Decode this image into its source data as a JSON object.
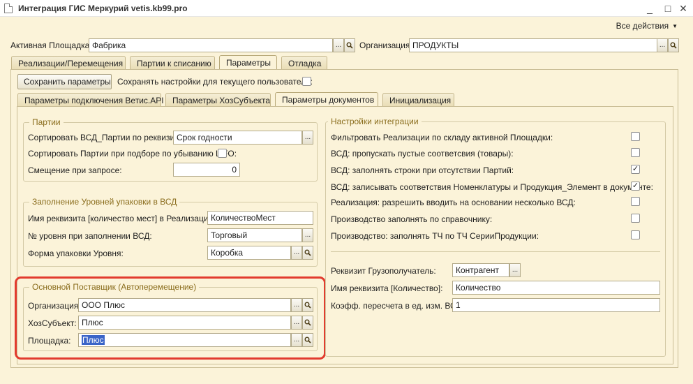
{
  "window": {
    "title": "Интеграция ГИС Меркурий vetis.kb99.pro",
    "minimize": "_",
    "maximize": "□",
    "close": "✕"
  },
  "toolbar": {
    "all_actions": "Все действия"
  },
  "header": {
    "platform_label": "Активная Площадка:",
    "platform_value": "Фабрика",
    "org_label": "Организация:",
    "org_value": "ПРОДУКТЫ"
  },
  "tabs": [
    "Реализации/Перемещения",
    "Партии к списанию",
    "Параметры",
    "Отладка"
  ],
  "params": {
    "save_button": "Сохранить параметры",
    "save_for_user_label": "Сохранять настройки для текущего пользователя:",
    "save_for_user_checked": false
  },
  "subtabs": [
    "Параметры подключения Ветис.API",
    "Параметры ХозСубъекта",
    "Параметры документов",
    "Инициализация"
  ],
  "batches": {
    "title": "Партии",
    "sort_vsd_label": "Сортировать ВСД_Партии по реквизиту:",
    "sort_vsd_value": "Срок годности",
    "sort_lifo_label": "Сортировать Партии при подборе по убыванию LIFO:",
    "sort_lifo_checked": false,
    "offset_label": "Смещение при запросе:",
    "offset_value": "0"
  },
  "packaging": {
    "title": "Заполнение Уровней упаковки в ВСД",
    "qty_attr_label": "Имя реквизита [количество мест] в Реализации:",
    "qty_attr_value": "КоличествоМест",
    "level_label": "№ уровня при заполнении ВСД:",
    "level_value": "Торговый",
    "form_label": "Форма упаковки Уровня:",
    "form_value": "Коробка"
  },
  "supplier": {
    "title": "Основной Поставщик (Автоперемещение)",
    "org_label": "Организация:",
    "org_value": "ООО Плюс",
    "entity_label": "ХозСубъект:",
    "entity_value": "Плюс",
    "site_label": "Площадка:",
    "site_value": "Плюс"
  },
  "integration": {
    "title": "Настройки интеграции",
    "options": [
      {
        "label": "Фильтровать Реализации по складу активной Площадки:",
        "checked": false
      },
      {
        "label": "ВСД: пропускать пустые соответсвия (товары):",
        "checked": false
      },
      {
        "label": "ВСД: заполнять строки при отсутствии Партий:",
        "checked": true
      },
      {
        "label": "ВСД: записывать соответствия Номенклатуры и Продукция_Элемент в документе:",
        "checked": true
      },
      {
        "label": "Реализация: разрешить вводить на основании несколько ВСД:",
        "checked": false
      },
      {
        "label": "Производство заполнять по справочнику:",
        "checked": false
      },
      {
        "label": "Производство: заполнять ТЧ по ТЧ СерииПродукции:",
        "checked": false
      }
    ],
    "consignee_label": "Реквизит Грузополучатель:",
    "consignee_value": "Контрагент",
    "qty_attr_label": "Имя реквизита [Количество]:",
    "qty_attr_value": "Количество",
    "coef_label": "Коэфф. пересчета в ед. изм. ВСД:",
    "coef_value": "1"
  },
  "icons": {
    "ellipsis": "...",
    "search": "magnifier-icon",
    "check": "✓"
  }
}
